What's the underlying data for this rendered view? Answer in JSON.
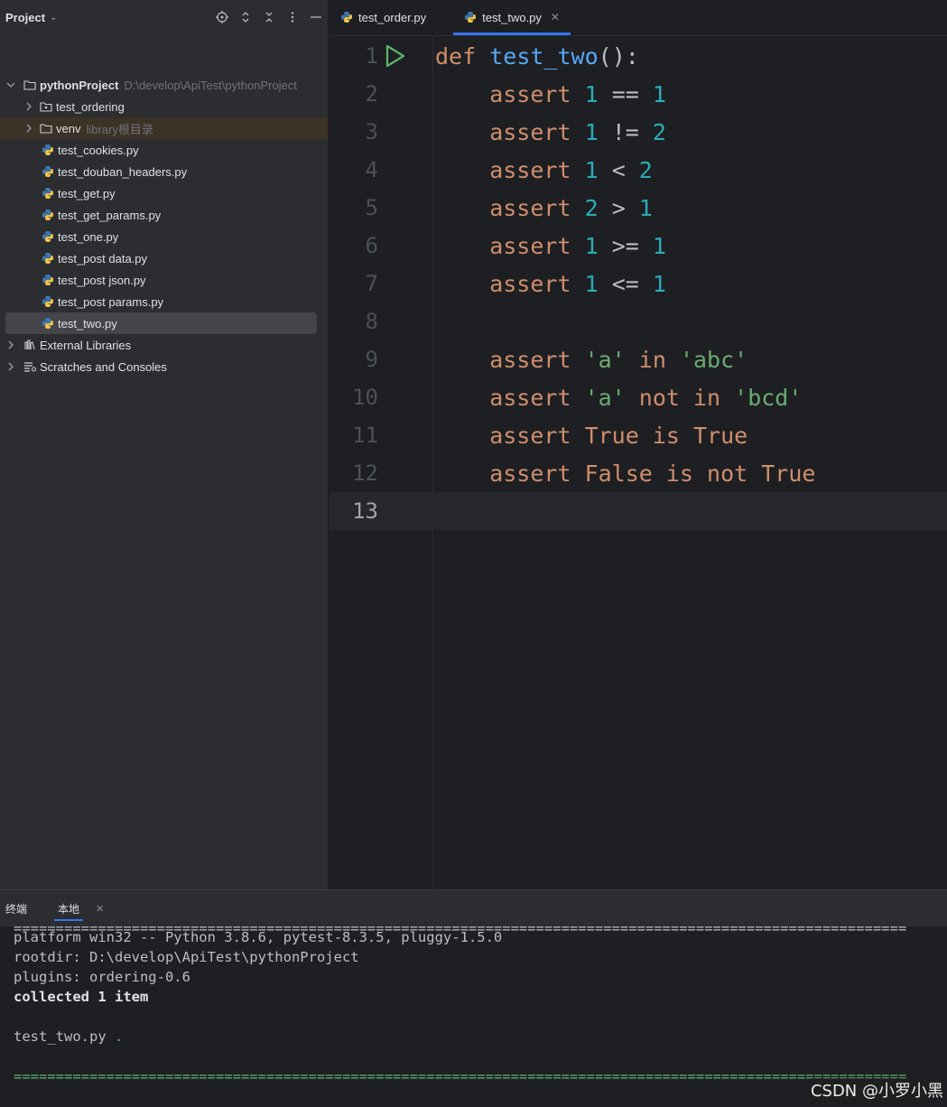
{
  "project_panel": {
    "title": "Project",
    "root": {
      "name": "pythonProject",
      "path": "D:\\develop\\ApiTest\\pythonProject"
    },
    "items": [
      {
        "label": "test_ordering",
        "type": "folder"
      },
      {
        "label": "venv",
        "sub": "library根目录",
        "type": "folder"
      },
      {
        "label": "test_cookies.py",
        "type": "py"
      },
      {
        "label": "test_douban_headers.py",
        "type": "py"
      },
      {
        "label": "test_get.py",
        "type": "py"
      },
      {
        "label": "test_get_params.py",
        "type": "py"
      },
      {
        "label": "test_one.py",
        "type": "py"
      },
      {
        "label": "test_post data.py",
        "type": "py"
      },
      {
        "label": "test_post json.py",
        "type": "py"
      },
      {
        "label": "test_post params.py",
        "type": "py"
      },
      {
        "label": "test_two.py",
        "type": "py",
        "selected": true
      }
    ],
    "external_libraries": "External Libraries",
    "scratches": "Scratches and Consoles"
  },
  "editor": {
    "tabs": [
      {
        "label": "test_order.py",
        "active": false
      },
      {
        "label": "test_two.py",
        "active": true
      }
    ],
    "current_line": 13,
    "lines": [
      {
        "n": "1",
        "tokens": [
          [
            "kw",
            "def "
          ],
          [
            "fn",
            "test_two"
          ],
          [
            "op",
            "():"
          ]
        ]
      },
      {
        "n": "2",
        "tokens": [
          [
            "kw",
            "    assert "
          ],
          [
            "num",
            "1"
          ],
          [
            "op",
            " == "
          ],
          [
            "num",
            "1"
          ]
        ]
      },
      {
        "n": "3",
        "tokens": [
          [
            "kw",
            "    assert "
          ],
          [
            "num",
            "1"
          ],
          [
            "op",
            " != "
          ],
          [
            "num",
            "2"
          ]
        ]
      },
      {
        "n": "4",
        "tokens": [
          [
            "kw",
            "    assert "
          ],
          [
            "num",
            "1"
          ],
          [
            "op",
            " < "
          ],
          [
            "num",
            "2"
          ]
        ]
      },
      {
        "n": "5",
        "tokens": [
          [
            "kw",
            "    assert "
          ],
          [
            "num",
            "2"
          ],
          [
            "op",
            " > "
          ],
          [
            "num",
            "1"
          ]
        ]
      },
      {
        "n": "6",
        "tokens": [
          [
            "kw",
            "    assert "
          ],
          [
            "num",
            "1"
          ],
          [
            "op",
            " >= "
          ],
          [
            "num",
            "1"
          ]
        ]
      },
      {
        "n": "7",
        "tokens": [
          [
            "kw",
            "    assert "
          ],
          [
            "num",
            "1"
          ],
          [
            "op",
            " <= "
          ],
          [
            "num",
            "1"
          ]
        ]
      },
      {
        "n": "8",
        "tokens": []
      },
      {
        "n": "9",
        "tokens": [
          [
            "kw",
            "    assert "
          ],
          [
            "str",
            "'a'"
          ],
          [
            "kw",
            " in "
          ],
          [
            "str",
            "'abc'"
          ]
        ]
      },
      {
        "n": "10",
        "tokens": [
          [
            "kw",
            "    assert "
          ],
          [
            "str",
            "'a'"
          ],
          [
            "kw",
            " not in "
          ],
          [
            "str",
            "'bcd'"
          ]
        ]
      },
      {
        "n": "11",
        "tokens": [
          [
            "kw",
            "    assert True is True"
          ]
        ]
      },
      {
        "n": "12",
        "tokens": [
          [
            "kw",
            "    assert False is not True"
          ]
        ]
      },
      {
        "n": "13",
        "tokens": []
      }
    ]
  },
  "terminal": {
    "title": "终端",
    "tab_label": "本地",
    "lines": [
      {
        "text": "==========================================================================================================",
        "style": "plain"
      },
      {
        "text": "platform win32 -- Python 3.8.6, pytest-8.3.5, pluggy-1.5.0",
        "style": "plain"
      },
      {
        "text": "rootdir: D:\\develop\\ApiTest\\pythonProject",
        "style": "plain"
      },
      {
        "text": "plugins: ordering-0.6",
        "style": "plain"
      },
      {
        "text": "collected 1 item",
        "style": "bold"
      },
      {
        "text": "",
        "style": "plain"
      },
      {
        "text": "test_two.py",
        "suffix": " .",
        "style": "plain"
      },
      {
        "text": "",
        "style": "plain"
      },
      {
        "text": "==========================================================================================================",
        "style": "green"
      }
    ],
    "watermark": "CSDN @小罗小黑"
  },
  "colors": {
    "keyword": "#cf8e6d",
    "function": "#56a8f5",
    "number": "#2aacb8",
    "string": "#6aab73",
    "accent": "#3574f0"
  }
}
